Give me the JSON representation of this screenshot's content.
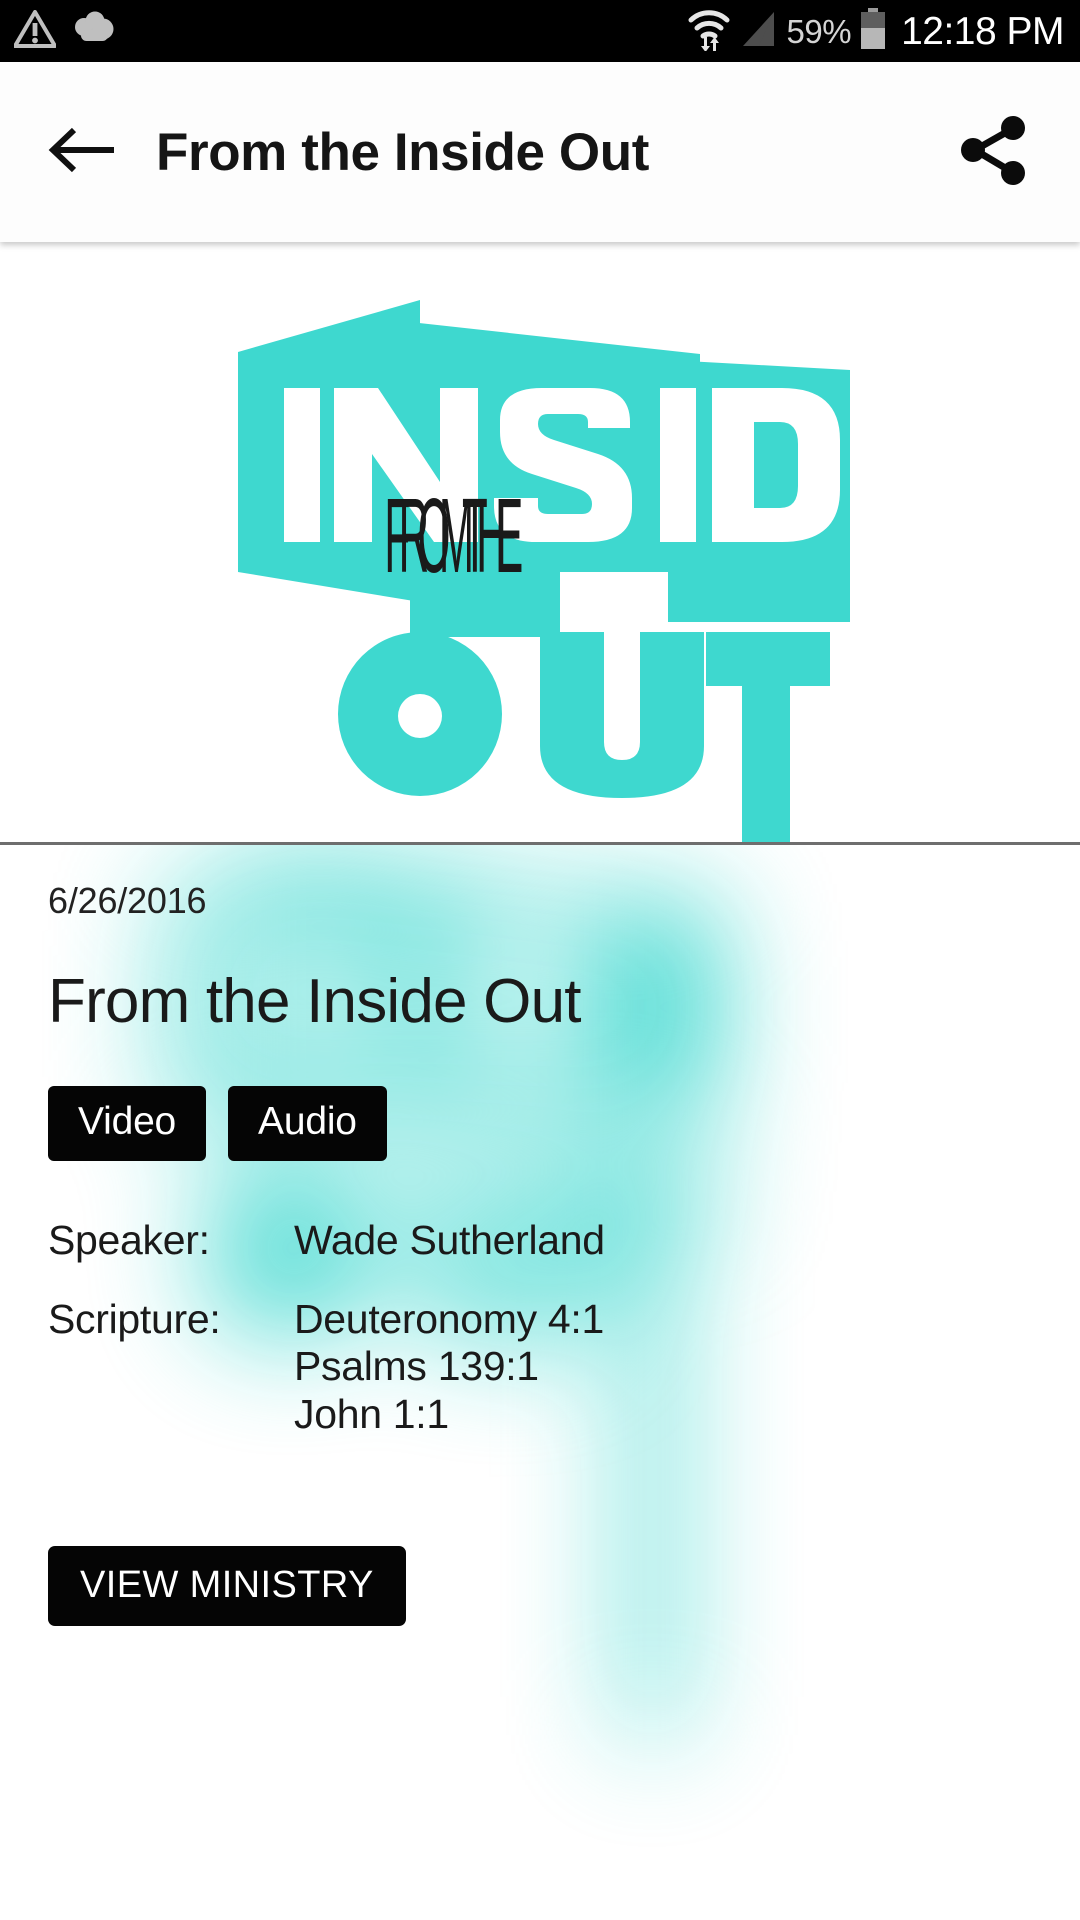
{
  "status_bar": {
    "icons": [
      "warning-triangle-icon",
      "cloud-icon",
      "wifi-icon",
      "cellular-signal-icon",
      "battery-icon"
    ],
    "battery_percent": "59%",
    "clock": "12:18 PM"
  },
  "app_bar": {
    "back_icon": "back-arrow-icon",
    "title": "From the Inside Out",
    "share_icon": "share-icon"
  },
  "hero": {
    "logo_alt": "From the Inside Out",
    "logo_line1": "FROM THE",
    "logo_line2": "INSIDE",
    "logo_line3": "OUT",
    "accent_color": "#3ed8cf"
  },
  "sermon": {
    "date": "6/26/2016",
    "title": "From the Inside Out",
    "media_buttons": [
      {
        "label": "Video"
      },
      {
        "label": "Audio"
      }
    ],
    "speaker_label": "Speaker:",
    "speaker_value": "Wade Sutherland",
    "scripture_label": "Scripture:",
    "scripture_values": [
      "Deuteronomy 4:1",
      "Psalms 139:1",
      "John 1:1"
    ],
    "view_ministry_label": "VIEW MINISTRY"
  },
  "colors": {
    "accent_teal": "#3ed8cf",
    "button_black": "#050505",
    "status_bar_black": "#000000",
    "divider_gray": "#6e6e6e"
  }
}
